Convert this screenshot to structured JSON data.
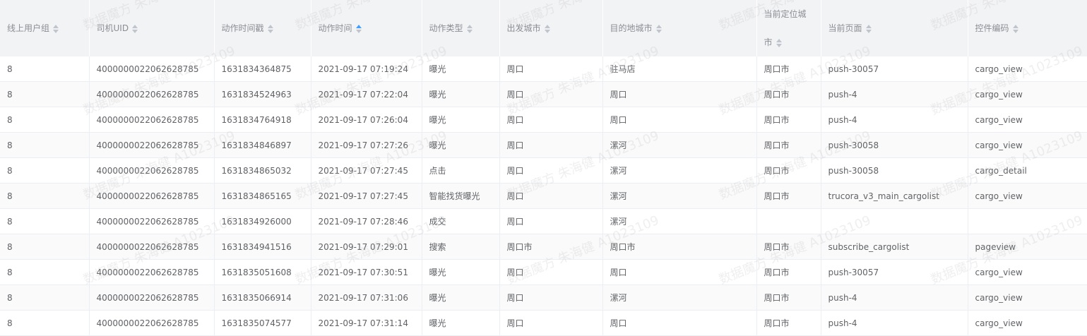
{
  "watermark": "数据魔方 朱海健 A1023109",
  "columns": [
    {
      "label": "线上用户组",
      "sort": "none"
    },
    {
      "label": "司机UID",
      "sort": "none"
    },
    {
      "label": "动作时间戳",
      "sort": "none"
    },
    {
      "label": "动作时间",
      "sort": "ascending"
    },
    {
      "label": "动作类型",
      "sort": "none"
    },
    {
      "label": "出发城市",
      "sort": "none"
    },
    {
      "label": "目的地城市",
      "sort": "none"
    },
    {
      "label": "当前定位城市",
      "sort": "none"
    },
    {
      "label": "当前页面",
      "sort": "none"
    },
    {
      "label": "控件编码",
      "sort": "none"
    }
  ],
  "rows": [
    [
      "8",
      "4000000022062628785",
      "1631834364875",
      "2021-09-17 07:19:24",
      "曝光",
      "周口",
      "驻马店",
      "周口市",
      "push-30057",
      "cargo_view"
    ],
    [
      "8",
      "4000000022062628785",
      "1631834524963",
      "2021-09-17 07:22:04",
      "曝光",
      "周口",
      "周口",
      "周口市",
      "push-4",
      "cargo_view"
    ],
    [
      "8",
      "4000000022062628785",
      "1631834764918",
      "2021-09-17 07:26:04",
      "曝光",
      "周口",
      "周口",
      "周口市",
      "push-4",
      "cargo_view"
    ],
    [
      "8",
      "4000000022062628785",
      "1631834846897",
      "2021-09-17 07:27:26",
      "曝光",
      "周口",
      "漯河",
      "周口市",
      "push-30058",
      "cargo_view"
    ],
    [
      "8",
      "4000000022062628785",
      "1631834865032",
      "2021-09-17 07:27:45",
      "点击",
      "周口",
      "漯河",
      "周口市",
      "push-30058",
      "cargo_detail"
    ],
    [
      "8",
      "4000000022062628785",
      "1631834865165",
      "2021-09-17 07:27:45",
      "智能找货曝光",
      "周口",
      "漯河",
      "周口市",
      "trucora_v3_main_cargolist",
      "cargo_view"
    ],
    [
      "8",
      "4000000022062628785",
      "1631834926000",
      "2021-09-17 07:28:46",
      "成交",
      "周口",
      "漯河",
      "",
      "",
      ""
    ],
    [
      "8",
      "4000000022062628785",
      "1631834941516",
      "2021-09-17 07:29:01",
      "搜索",
      "周口市",
      "周口市",
      "周口市",
      "subscribe_cargolist",
      "pageview"
    ],
    [
      "8",
      "4000000022062628785",
      "1631835051608",
      "2021-09-17 07:30:51",
      "曝光",
      "周口",
      "周口",
      "周口市",
      "push-30057",
      "cargo_view"
    ],
    [
      "8",
      "4000000022062628785",
      "1631835066914",
      "2021-09-17 07:31:06",
      "曝光",
      "周口",
      "漯河",
      "周口市",
      "push-4",
      "cargo_view"
    ],
    [
      "8",
      "4000000022062628785",
      "1631835074577",
      "2021-09-17 07:31:14",
      "曝光",
      "周口",
      "周口",
      "周口市",
      "push-4",
      "cargo_view"
    ]
  ]
}
